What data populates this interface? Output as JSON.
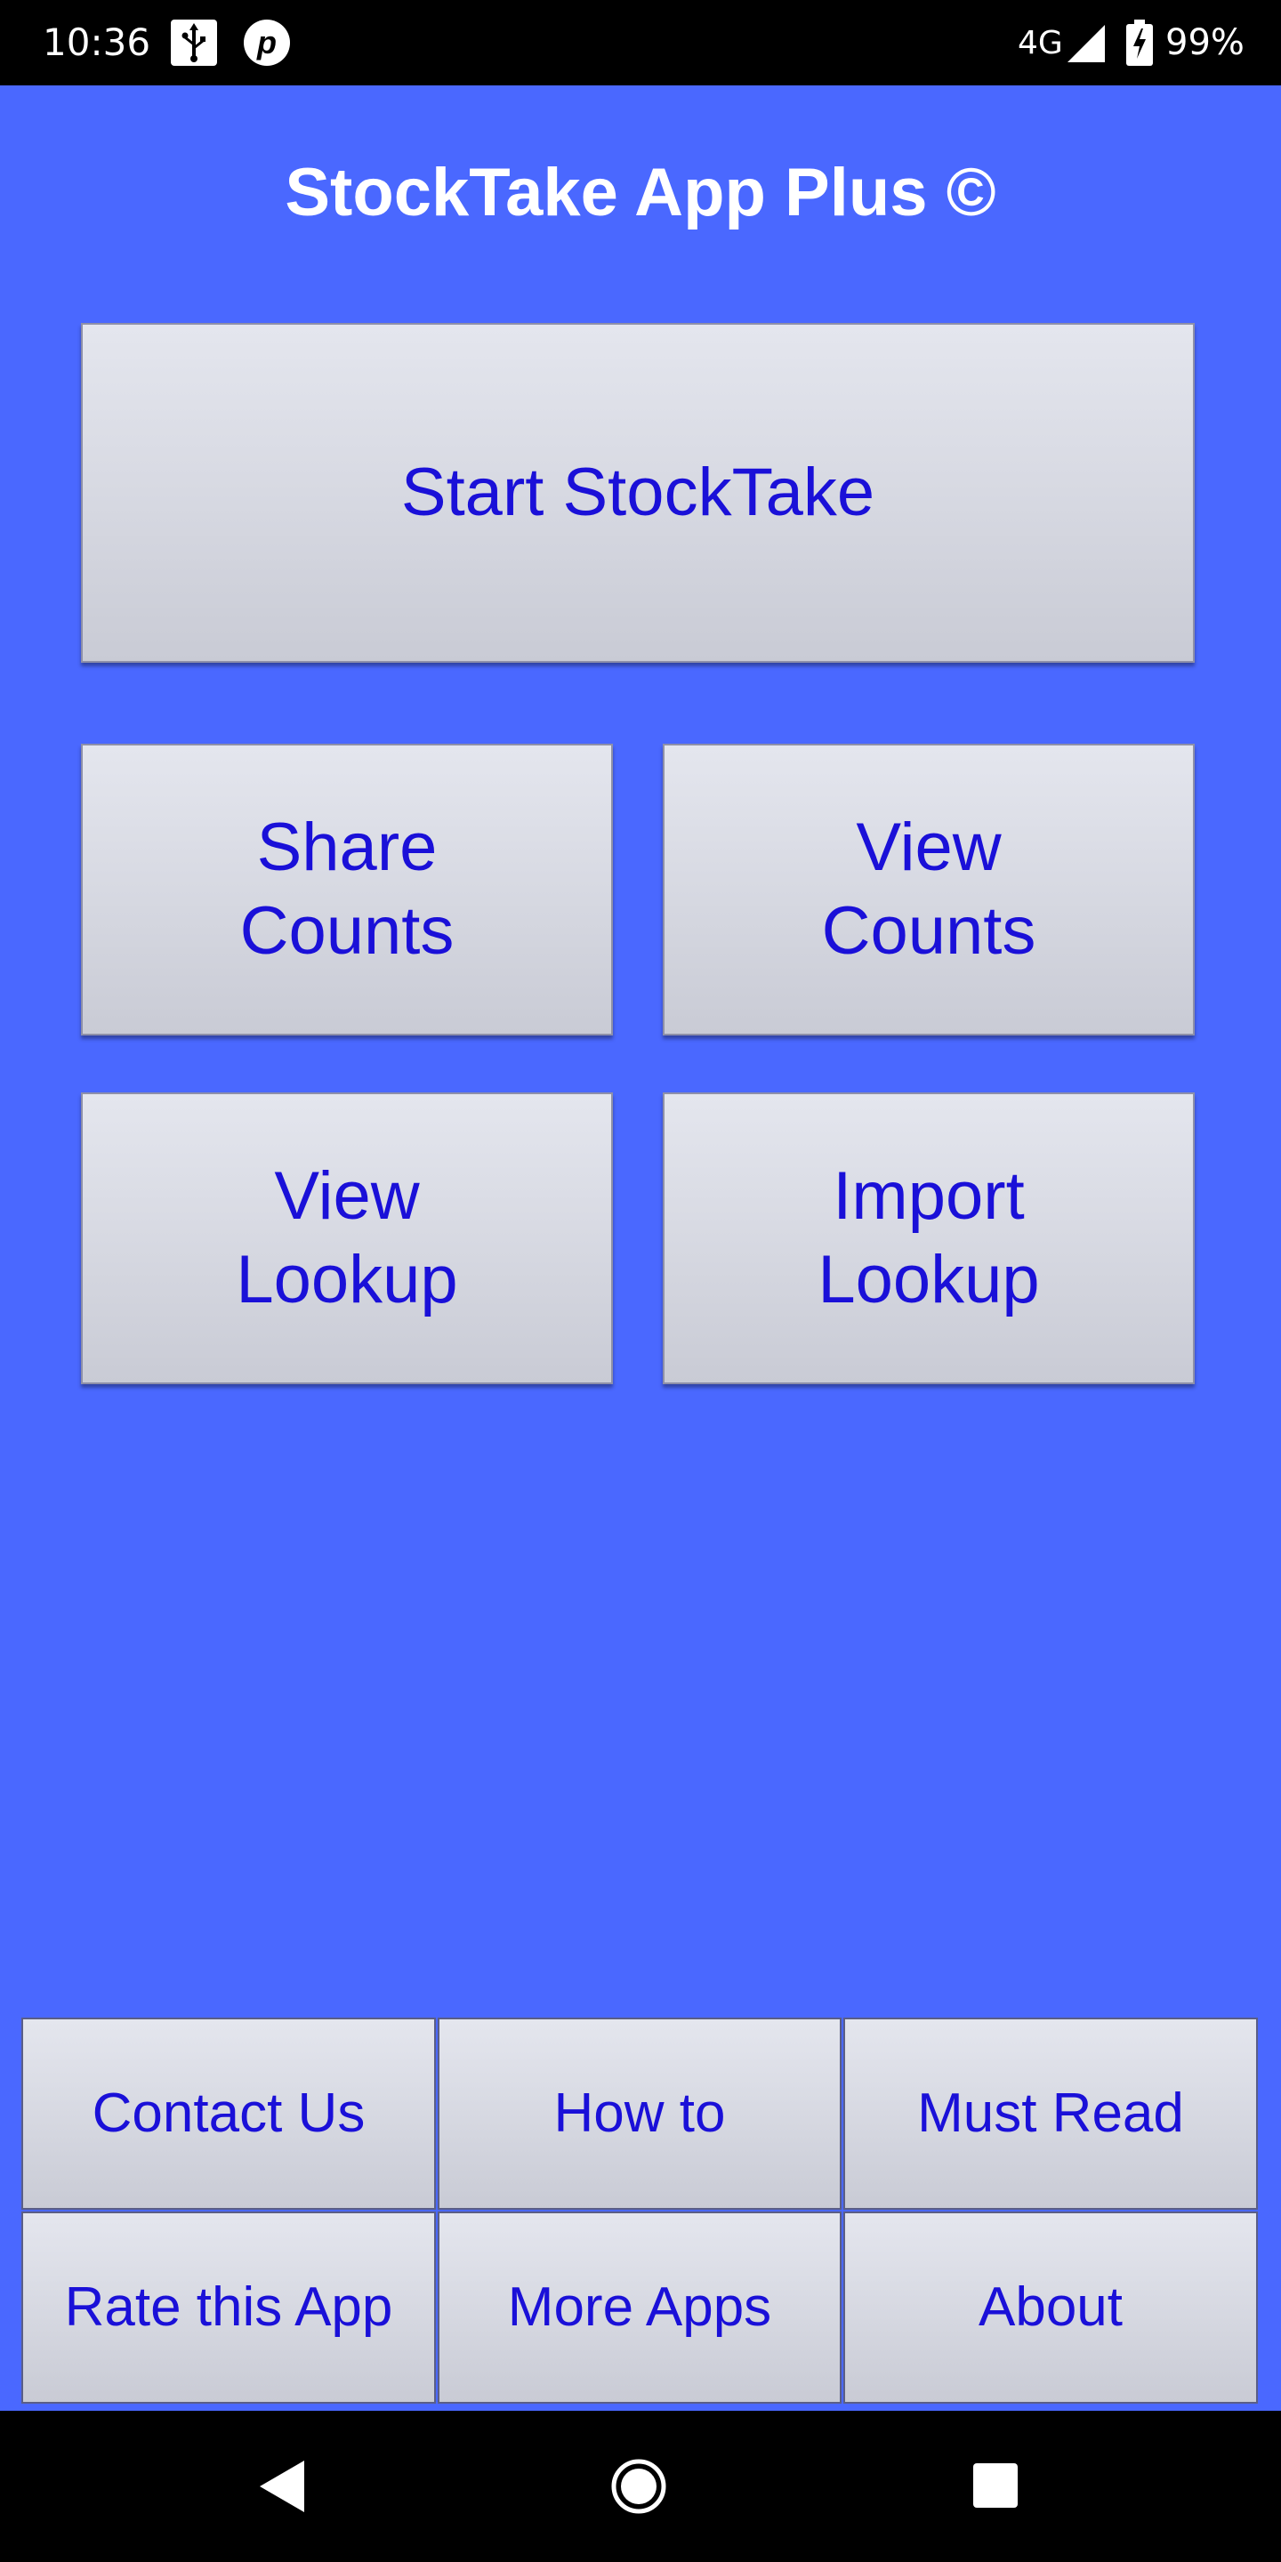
{
  "status_bar": {
    "time": "10:36",
    "network": "4G",
    "battery": "99%",
    "usb_icon": "usb-icon",
    "p_icon": "p-icon"
  },
  "app": {
    "title": "StockTake App Plus ©"
  },
  "main_buttons": {
    "start": "Start StockTake",
    "share_line1": "Share",
    "share_line2": "Counts",
    "view_counts_line1": "View",
    "view_counts_line2": "Counts",
    "view_lookup_line1": "View",
    "view_lookup_line2": "Lookup",
    "import_lookup_line1": "Import",
    "import_lookup_line2": "Lookup"
  },
  "footer_buttons": {
    "contact": "Contact Us",
    "howto": "How to",
    "mustread": "Must Read",
    "rate": "Rate this App",
    "moreapps": "More Apps",
    "about": "About"
  },
  "colors": {
    "background": "#4A68FF",
    "button_text": "#1A10D8",
    "title_text": "#FFFFFF"
  },
  "nav_bar": {
    "back_icon": "back-triangle-icon",
    "home_icon": "home-circle-icon",
    "recent_icon": "recent-square-icon"
  }
}
